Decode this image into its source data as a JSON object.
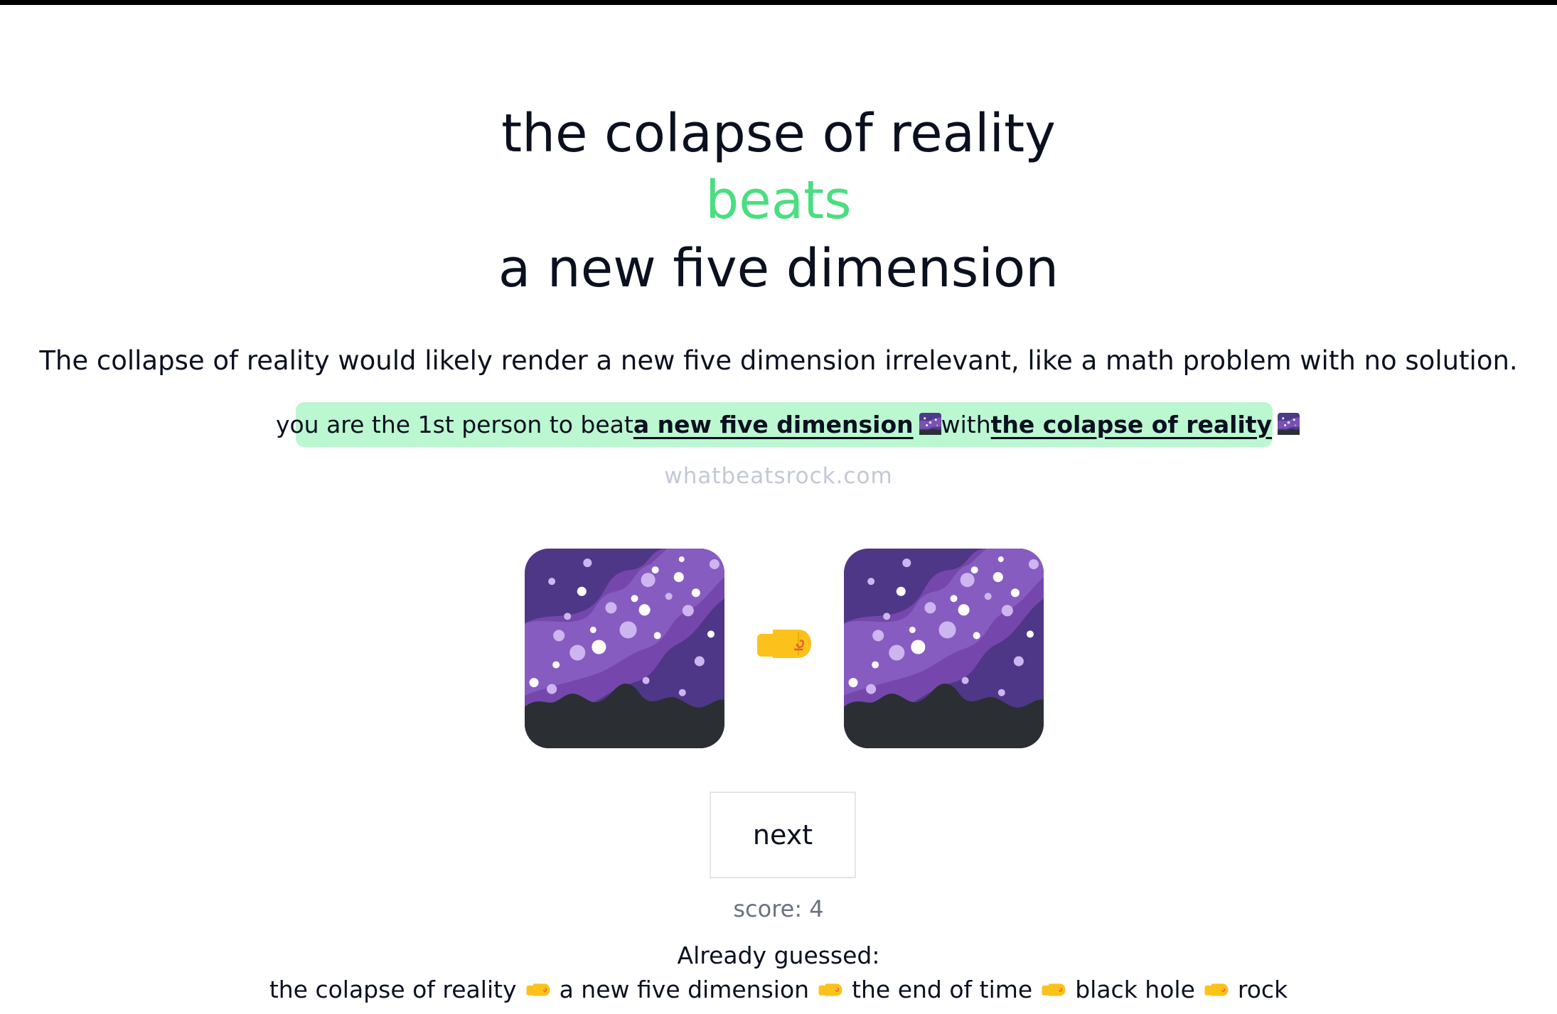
{
  "result": {
    "winner": "the colapse of reality",
    "verb": "beats",
    "loser": "a new five dimension",
    "verb_color": "#4ade80"
  },
  "explanation": "The collapse of reality would likely render a new five dimension irrelevant, like a math problem with no solution.",
  "banner": {
    "icon": "trophy-icon",
    "prefix": "you are the 1st person to beat",
    "loser_link": "a new five dimension",
    "connector": "with",
    "winner_link": "the colapse of reality",
    "link_icon": "milky-way-icon",
    "background": "#bbf7d0"
  },
  "watermark": "whatbeatsrock.com",
  "images": {
    "left": "milky-way-icon",
    "middle": "fist-bump-icon",
    "right": "milky-way-icon"
  },
  "next_label": "next",
  "score_label": "score: 4",
  "history": {
    "title": "Already guessed:",
    "items": [
      "the colapse of reality",
      "a new five dimension",
      "the end of time",
      "black hole",
      "rock"
    ],
    "separator_icon": "fist-bump-icon"
  }
}
